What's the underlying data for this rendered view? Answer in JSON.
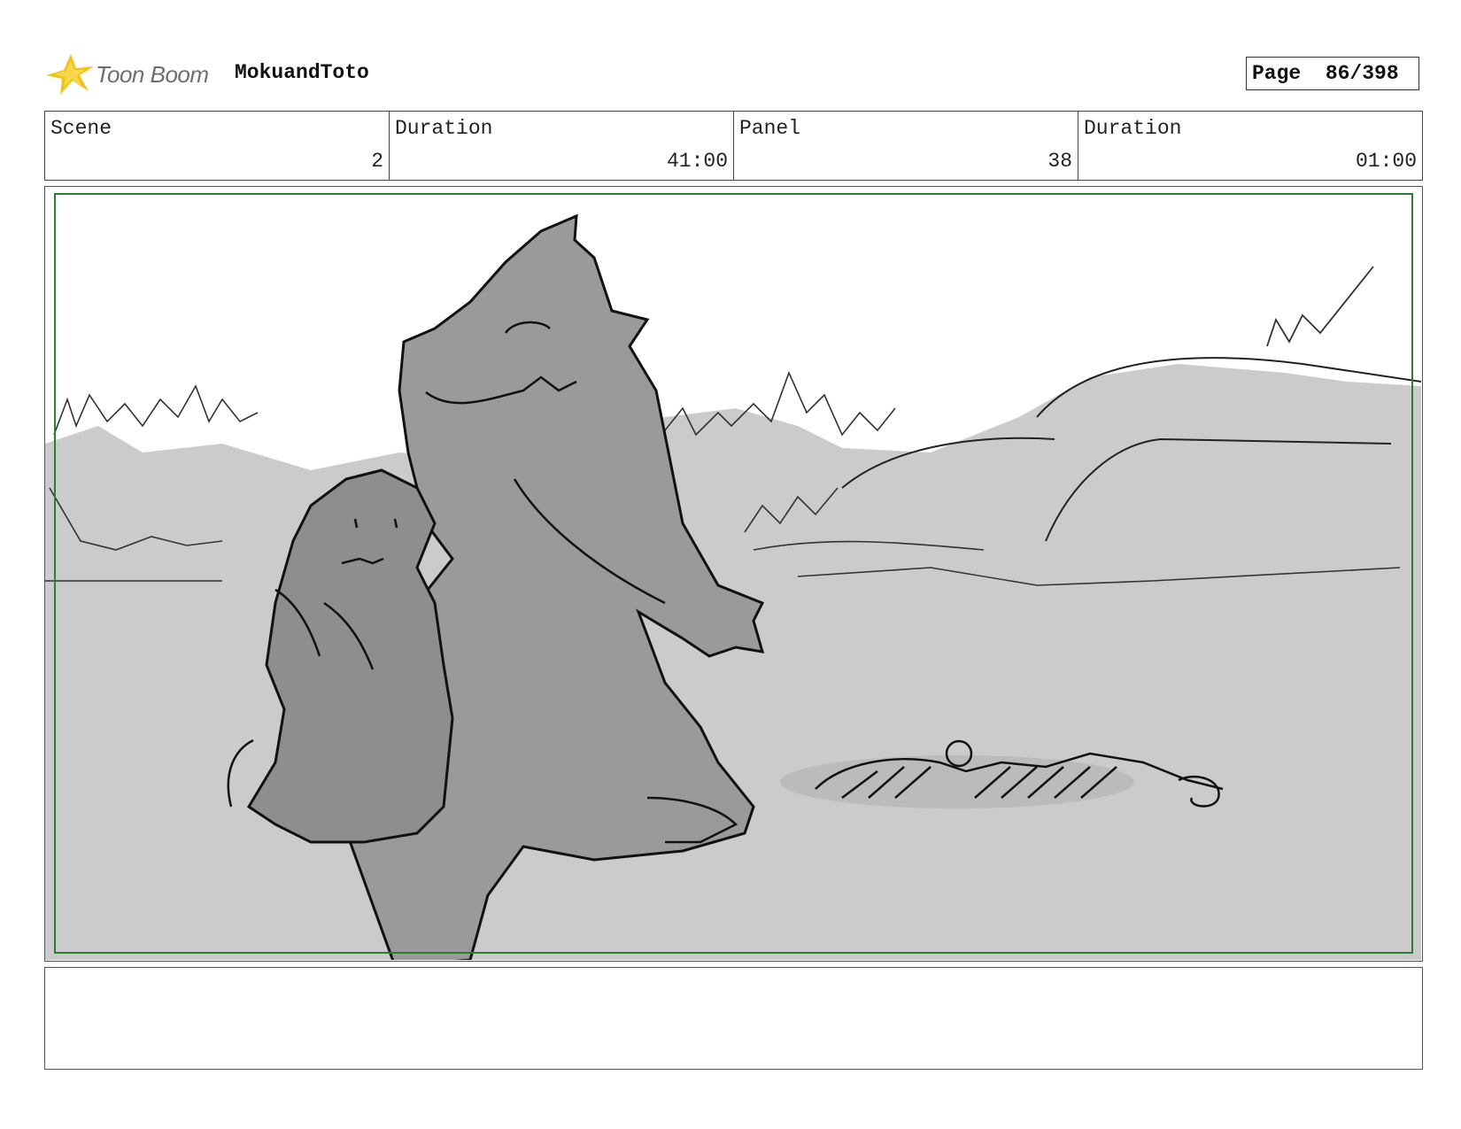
{
  "header": {
    "logo_text": "Toon Boom",
    "logo_icon": "toon-boom-star-icon",
    "project_title": "MokuandToto",
    "page_label": "Page",
    "page_value": "86/398"
  },
  "info": {
    "scene_label": "Scene",
    "scene_value": "2",
    "scene_duration_label": "Duration",
    "scene_duration_value": "41:00",
    "panel_label": "Panel",
    "panel_value": "38",
    "panel_duration_label": "Duration",
    "panel_duration_value": "01:00"
  },
  "panel": {
    "safe_frame_color": "#2f7d32",
    "ground_color": "#cbcbcb",
    "character_color": "#9a9a9a"
  },
  "notes": {
    "text": ""
  }
}
